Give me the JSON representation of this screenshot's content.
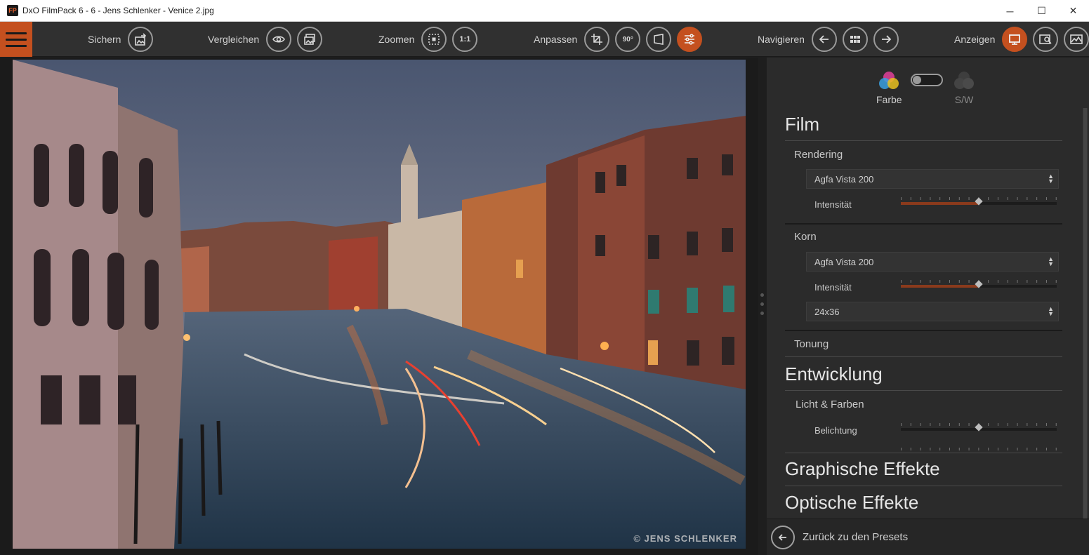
{
  "window": {
    "app_icon": "FP",
    "title": "DxO FilmPack 6 - 6 - Jens Schlenker - Venice 2.jpg",
    "minimize_glyph": "─",
    "maximize_glyph": "☐",
    "close_glyph": "✕"
  },
  "toolbar": {
    "save_label": "Sichern",
    "compare_label": "Vergleichen",
    "zoom_label": "Zoomen",
    "zoom_100": "1:1",
    "adjust_label": "Anpassen",
    "rotate_label": "90°",
    "navigate_label": "Navigieren",
    "display_label": "Anzeigen",
    "accent_color": "#c4501f"
  },
  "viewer": {
    "watermark": "© JENS SCHLENKER"
  },
  "panel": {
    "mode_color_label": "Farbe",
    "mode_bw_label": "S/W",
    "mode_toggle_on": false,
    "film": {
      "title": "Film",
      "rendering": {
        "title": "Rendering",
        "preset": "Agfa Vista 200",
        "intensity_label": "Intensität",
        "intensity_fraction": 0.5
      },
      "grain": {
        "title": "Korn",
        "preset": "Agfa Vista 200",
        "intensity_label": "Intensität",
        "intensity_fraction": 0.5,
        "format": "24x36"
      },
      "toning_title": "Tonung"
    },
    "development": {
      "title": "Entwicklung",
      "light_colors_title": "Licht & Farben",
      "exposure_label": "Belichtung",
      "exposure_fraction": 0.5
    },
    "graphic_effects_title": "Graphische Effekte",
    "optical_effects_title": "Optische Effekte",
    "back_label": "Zurück zu den Presets"
  }
}
